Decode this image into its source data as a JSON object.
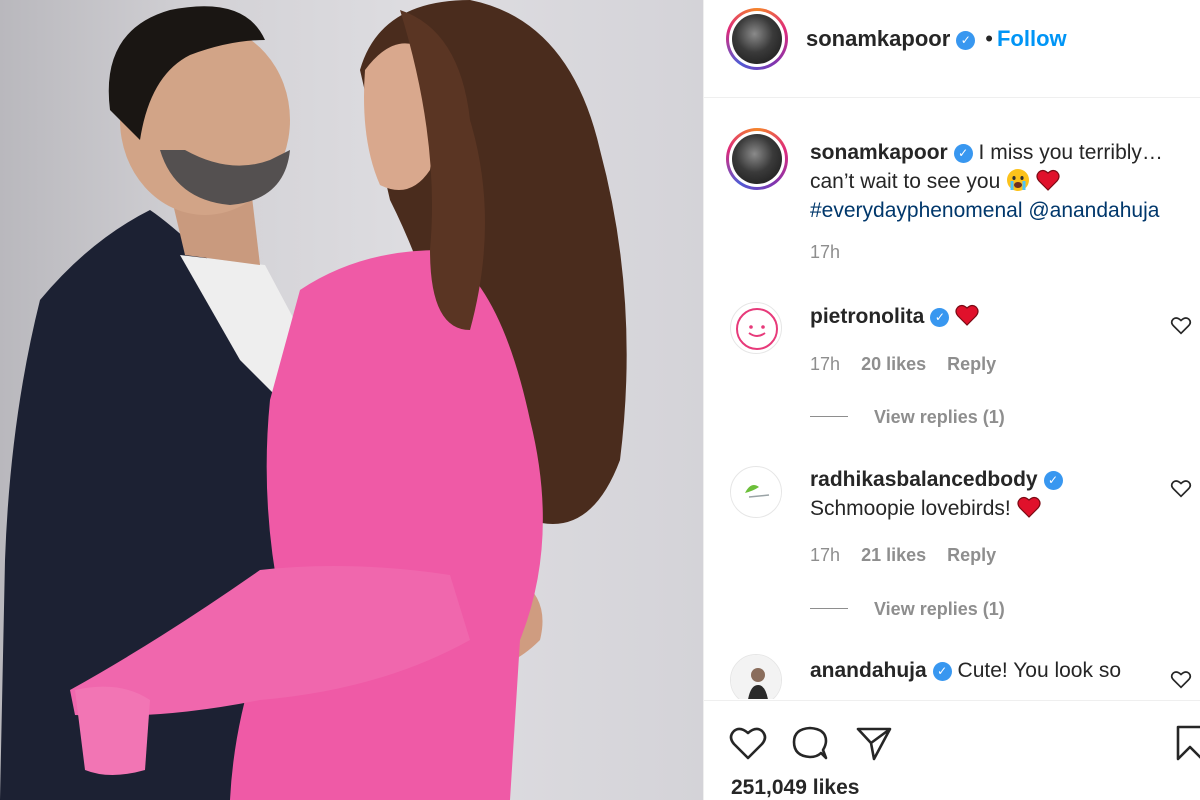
{
  "post": {
    "author": "sonamkapoor",
    "follow_label": "Follow",
    "separator": "•"
  },
  "caption": {
    "author": "sonamkapoor",
    "text_line1": "I miss you terribly…",
    "text_line2": "can’t wait to see you",
    "hashtags": "#everydayphenomenal @anandahuja",
    "time": "17h"
  },
  "comments": [
    {
      "author": "pietronolita",
      "text": "",
      "time": "17h",
      "likes": "20 likes",
      "reply": "Reply",
      "view_replies": "View replies (1)"
    },
    {
      "author": "radhikasbalancedbody",
      "text": "Schmoopie lovebirds!",
      "time": "17h",
      "likes": "21 likes",
      "reply": "Reply",
      "view_replies": "View replies (1)"
    },
    {
      "author": "anandahuja",
      "text": "Cute! You look so"
    }
  ],
  "footer": {
    "likes_total": "251,049 likes"
  },
  "icons": [
    "verified-badge-icon",
    "heart-icon",
    "comment-icon",
    "share-icon",
    "bookmark-icon",
    "crying-face-icon",
    "red-heart-icon"
  ],
  "colors": {
    "link": "#0095f6",
    "hashtag": "#00376b",
    "verified": "#3897f0",
    "muted": "#8e8e8e",
    "heart": "#ed4956"
  }
}
